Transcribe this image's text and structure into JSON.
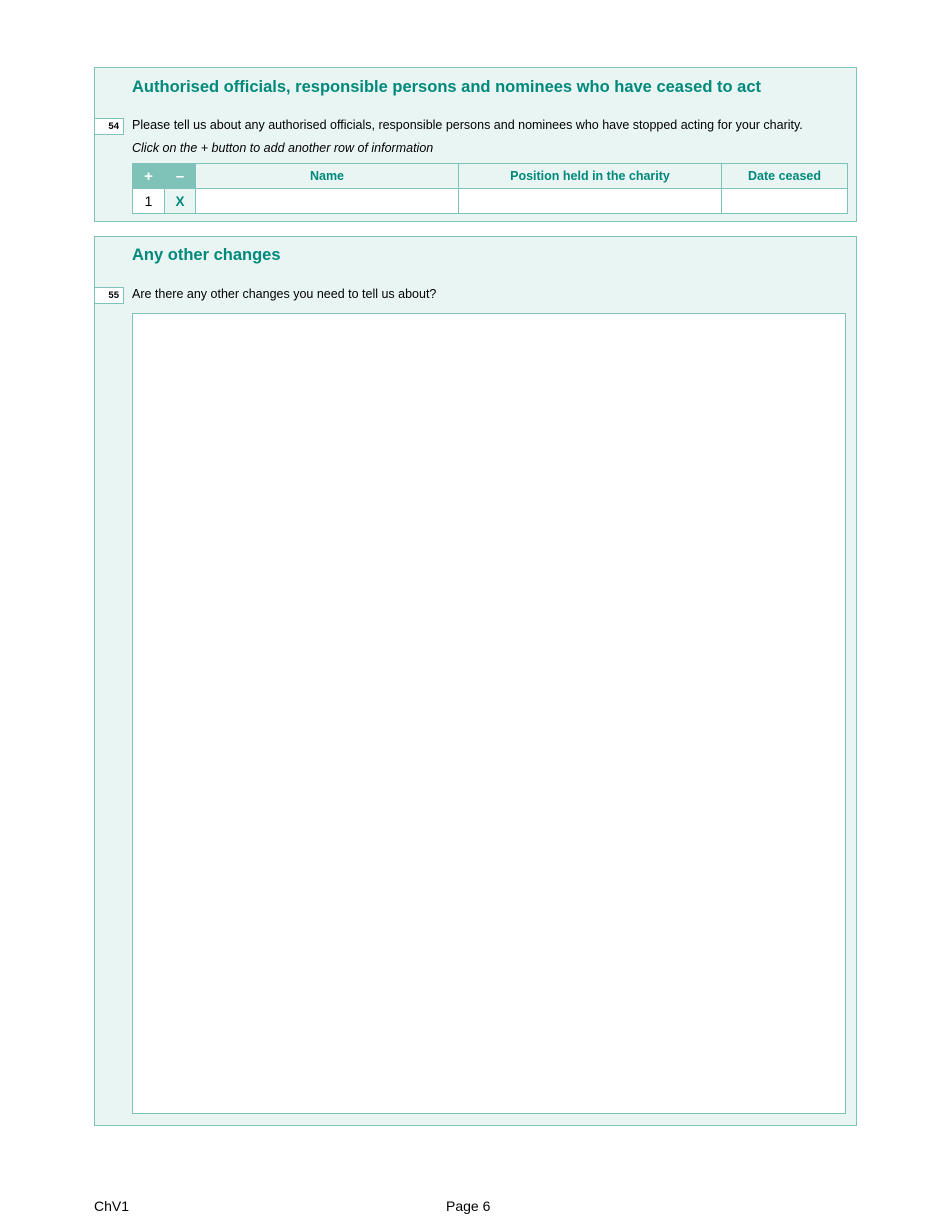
{
  "section54": {
    "title": "Authorised officials, responsible  persons and nominees who have ceased to act",
    "question_number": "54",
    "question_text": "Please tell us about any authorised officials, responsible persons and nominees who have stopped acting for your charity.",
    "instruction": "Click on the + button to add another row of information",
    "table": {
      "add_label": "+",
      "remove_label": "–",
      "columns": [
        "Name",
        "Position held in the charity",
        "Date ceased"
      ],
      "rows": [
        {
          "row_number": "1",
          "remove_label": "X",
          "name": "",
          "position": "",
          "date_ceased": ""
        }
      ]
    }
  },
  "section55": {
    "title": "Any other changes",
    "question_number": "55",
    "question_text": "Are there any other changes you need to tell us about?",
    "answer": ""
  },
  "footer": {
    "form_code": "ChV1",
    "page_label": "Page 6"
  },
  "colors": {
    "accent": "#00897b",
    "panel_background": "#e9f5f3",
    "border": "#7fc2b8"
  }
}
